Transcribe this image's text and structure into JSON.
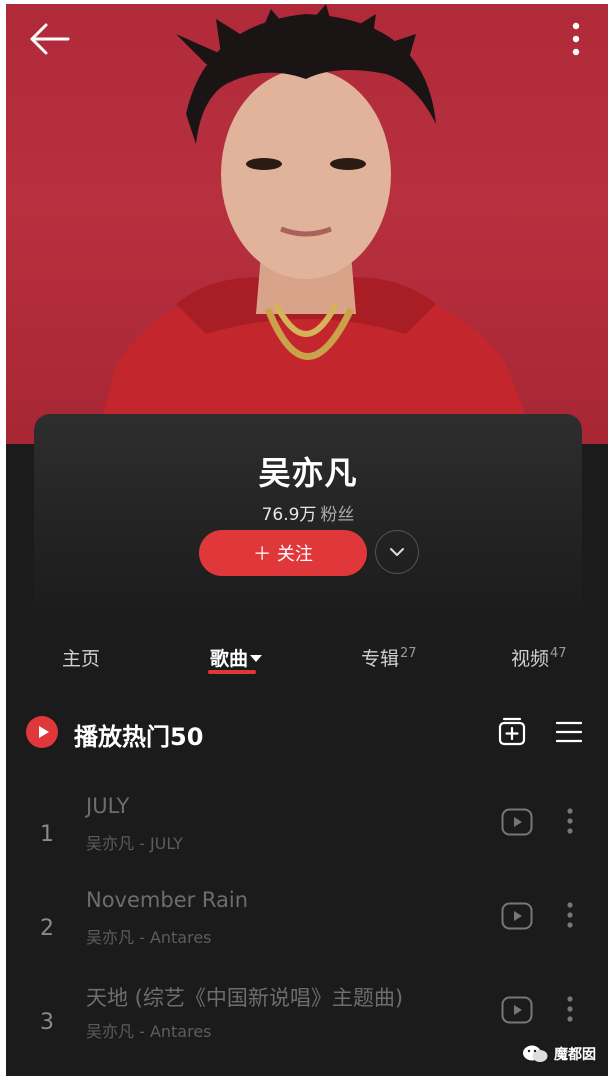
{
  "artist": {
    "name": "吴亦凡",
    "fans_count": "76.9万",
    "fans_label": "粉丝",
    "follow_label": "＋ 关注"
  },
  "tabs": [
    {
      "label": "主页",
      "count": "",
      "active": false
    },
    {
      "label": "歌曲",
      "count": "",
      "active": true
    },
    {
      "label": "专辑",
      "count": "27",
      "active": false
    },
    {
      "label": "视频",
      "count": "47",
      "active": false
    }
  ],
  "playlist": {
    "title": "播放热门50"
  },
  "songs": [
    {
      "index": "1",
      "title": "JULY",
      "subtitle": "吴亦凡 - JULY"
    },
    {
      "index": "2",
      "title": "November Rain",
      "subtitle": "吴亦凡 - Antares"
    },
    {
      "index": "3",
      "title": "天地 (综艺《中国新说唱》主题曲)",
      "subtitle": "吴亦凡 - Antares"
    }
  ],
  "icons": {
    "back": "back-arrow-icon",
    "more": "more-vertical-icon",
    "expand": "chevron-down-icon",
    "play_all": "play-circle-icon",
    "add_to_playlist": "add-playlist-icon",
    "list_menu": "list-menu-icon",
    "play_video": "play-video-icon"
  },
  "watermark": "魔都囡",
  "colors": {
    "accent": "#e0373a",
    "hero_background": "#b02a3a",
    "page_background": "#1b1b1b"
  }
}
